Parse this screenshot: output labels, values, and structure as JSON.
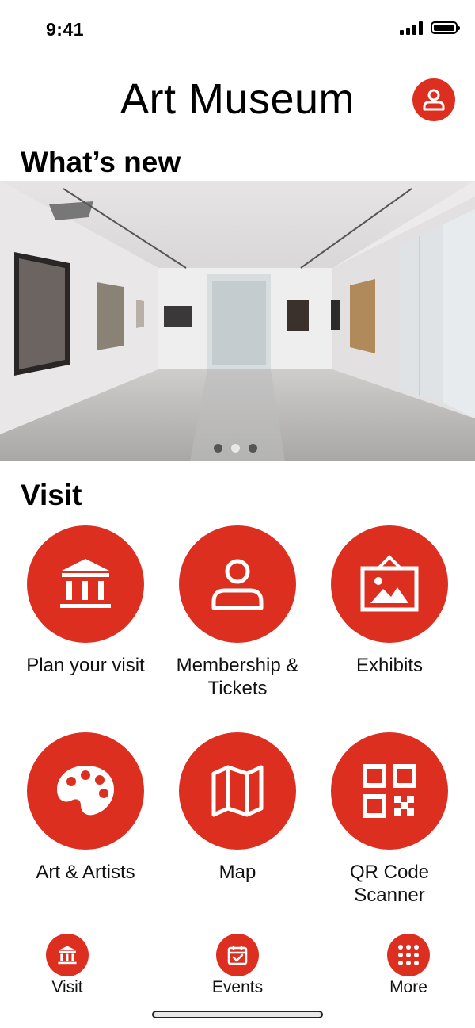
{
  "status_bar": {
    "time": "9:41"
  },
  "header": {
    "title": "Art Museum"
  },
  "whats_new": {
    "heading": "What’s new",
    "carousel_pages": 3,
    "active_page": 2
  },
  "visit": {
    "heading": "Visit",
    "tiles": [
      {
        "label": "Plan your visit",
        "icon": "museum-building-icon"
      },
      {
        "label": "Membership & Tickets",
        "icon": "person-icon"
      },
      {
        "label": "Exhibits",
        "icon": "picture-frame-icon"
      },
      {
        "label": "Art & Artists",
        "icon": "palette-icon"
      },
      {
        "label": "Map",
        "icon": "map-icon"
      },
      {
        "label": "QR Code Scanner",
        "icon": "qr-code-icon"
      }
    ]
  },
  "tabbar": {
    "tabs": [
      {
        "label": "Visit",
        "icon": "museum-building-icon"
      },
      {
        "label": "Events",
        "icon": "calendar-icon"
      },
      {
        "label": "More",
        "icon": "grid-dots-icon"
      }
    ]
  },
  "colors": {
    "accent": "#dd2f20",
    "background": "#ffffff",
    "text": "#000000"
  }
}
